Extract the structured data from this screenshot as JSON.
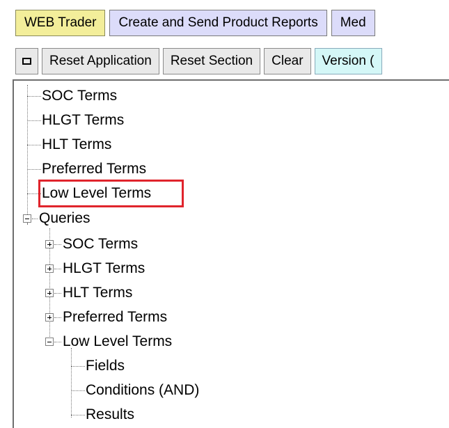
{
  "tabs": [
    {
      "label": "WEB Trader"
    },
    {
      "label": "Create and Send Product Reports"
    },
    {
      "label": "Med"
    }
  ],
  "toolbar": {
    "window_icon": "window-square-icon",
    "reset_application": "Reset Application",
    "reset_section": "Reset Section",
    "clear": "Clear",
    "version": "Version ("
  },
  "tree": {
    "top_items": [
      "SOC Terms",
      "HLGT Terms",
      "HLT Terms",
      "Preferred Terms",
      "Low Level Terms"
    ],
    "highlighted_item": "Low Level Terms",
    "queries": {
      "label": "Queries",
      "children": [
        "SOC Terms",
        "HLGT Terms",
        "HLT Terms",
        "Preferred Terms",
        "Low Level Terms"
      ],
      "low_level_children": [
        "Fields",
        "Conditions (AND)",
        "Results"
      ]
    }
  },
  "colors": {
    "web_trader_tab": "#f3ee9a",
    "other_tabs": "#dcdcfa",
    "version_button": "#d4f7f7",
    "highlight_border": "#e0242c"
  }
}
